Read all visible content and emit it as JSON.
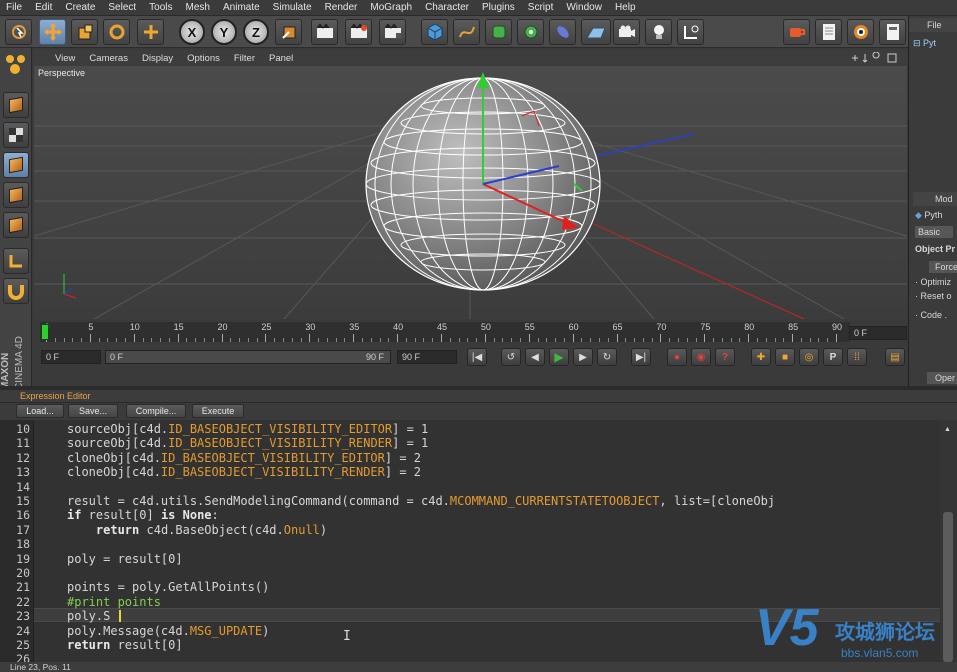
{
  "menu": [
    "File",
    "Edit",
    "Create",
    "Select",
    "Tools",
    "Mesh",
    "Animate",
    "Simulate",
    "Render",
    "MoGraph",
    "Character",
    "Plugins",
    "Script",
    "Window",
    "Help"
  ],
  "axis_buttons": [
    "X",
    "Y",
    "Z"
  ],
  "viewport": {
    "menu": [
      "View",
      "Cameras",
      "Display",
      "Options",
      "Filter",
      "Panel"
    ],
    "label": "Perspective"
  },
  "timeline": {
    "ticks": [
      "0",
      "5",
      "10",
      "15",
      "20",
      "25",
      "30",
      "35",
      "40",
      "45",
      "50",
      "55",
      "60",
      "65",
      "70",
      "75",
      "80",
      "85",
      "90"
    ],
    "current_frame": "0 F",
    "start_field": "0 F",
    "range_start": "0 F",
    "range_end": "90 F",
    "end_field": "90 F"
  },
  "brand": {
    "vertical_1": "MAXON",
    "vertical_2": "CINEMA 4D"
  },
  "right_panel": {
    "top_tab": "File",
    "object": "Pyt",
    "attr_tab": "Mod",
    "attr_object": "Pyth",
    "basic_tab": "Basic",
    "section": "Object Pr",
    "force_btn": "Force",
    "opt1": "Optimiz",
    "opt2": "Reset o",
    "code_label": "Code .",
    "open_btn": "Oper"
  },
  "editor": {
    "title": "Expression Editor",
    "buttons": [
      "Load...",
      "Save...",
      "Compile...",
      "Execute"
    ],
    "status": "Line 23, Pos. 11"
  },
  "code_lines": [
    {
      "n": "10",
      "t": "sourceObj[c4d.ID_BASEOBJECT_VISIBILITY_EDITOR] = 1"
    },
    {
      "n": "11",
      "t": "sourceObj[c4d.ID_BASEOBJECT_VISIBILITY_RENDER] = 1"
    },
    {
      "n": "12",
      "t": "cloneObj[c4d.ID_BASEOBJECT_VISIBILITY_EDITOR] = 2"
    },
    {
      "n": "13",
      "t": "cloneObj[c4d.ID_BASEOBJECT_VISIBILITY_RENDER] = 2"
    },
    {
      "n": "14",
      "t": ""
    },
    {
      "n": "15",
      "t": "result = c4d.utils.SendModelingCommand(command = c4d.MCOMMAND_CURRENTSTATETOOBJECT, list=[cloneObj"
    },
    {
      "n": "16",
      "t": "if result[0] is None:"
    },
    {
      "n": "17",
      "t": "    return c4d.BaseObject(c4d.Onull)"
    },
    {
      "n": "18",
      "t": ""
    },
    {
      "n": "19",
      "t": "poly = result[0]"
    },
    {
      "n": "20",
      "t": ""
    },
    {
      "n": "21",
      "t": "points = poly.GetAllPoints()"
    },
    {
      "n": "22",
      "t": "#print points"
    },
    {
      "n": "23",
      "t": "poly.S"
    },
    {
      "n": "24",
      "t": "poly.Message(c4d.MSG_UPDATE)"
    },
    {
      "n": "25",
      "t": "return result[0]"
    },
    {
      "n": "26",
      "t": ""
    }
  ],
  "watermark": {
    "logo": "V5",
    "title": "攻城狮论坛",
    "url": "bbs.vlan5.com"
  },
  "colors": {
    "accent": "#e9a24a",
    "keyword_const": "#e59b2f",
    "comment": "#7fd14e",
    "play": "#3fb83f"
  }
}
